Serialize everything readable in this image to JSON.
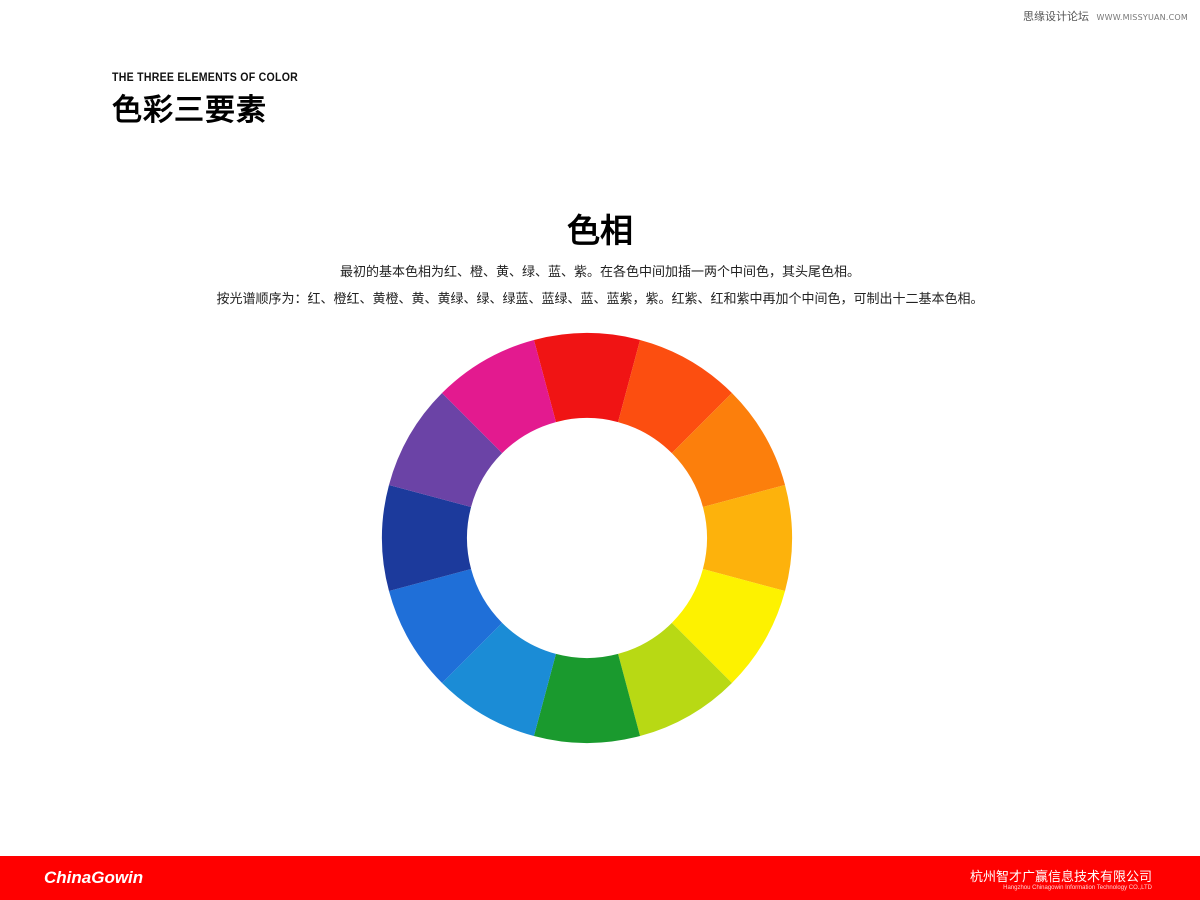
{
  "watermark": {
    "site_name": "思缘设计论坛",
    "site_url": "WWW.MISSYUAN.COM"
  },
  "heading": {
    "subtitle_en": "THE THREE ELEMENTS OF COLOR",
    "title_cn": "色彩三要素"
  },
  "section": {
    "title": "色相",
    "line1": "最初的基本色相为红、橙、黄、绿、蓝、紫。在各色中间加插一两个中间色，其头尾色相。",
    "line2": "按光谱顺序为：红、橙红、黄橙、黄、黄绿、绿、绿蓝、蓝绿、蓝、蓝紫，紫。红紫、红和紫中再加个中间色，可制出十二基本色相。"
  },
  "color_wheel": {
    "segments": [
      {
        "hue": "red",
        "color": "#f01414"
      },
      {
        "hue": "red-orange",
        "color": "#fc4e10"
      },
      {
        "hue": "orange",
        "color": "#fc7f0c"
      },
      {
        "hue": "yellow-orange",
        "color": "#fdb20c"
      },
      {
        "hue": "yellow",
        "color": "#fdf200"
      },
      {
        "hue": "yellow-green",
        "color": "#b8d914"
      },
      {
        "hue": "green",
        "color": "#1a9a2e"
      },
      {
        "hue": "blue-green",
        "color": "#1b8cd6"
      },
      {
        "hue": "blue",
        "color": "#1f6fd8"
      },
      {
        "hue": "blue-violet",
        "color": "#1c3a9c"
      },
      {
        "hue": "violet",
        "color": "#6b43a6"
      },
      {
        "hue": "red-violet",
        "color": "#e31a8f"
      }
    ]
  },
  "footer": {
    "logo": "ChinaGowin",
    "company_cn": "杭州智才广赢信息技术有限公司",
    "company_en": "Hangzhou Chinagowin Information Technology CO.,LTD",
    "background_color": "#ff0000"
  }
}
